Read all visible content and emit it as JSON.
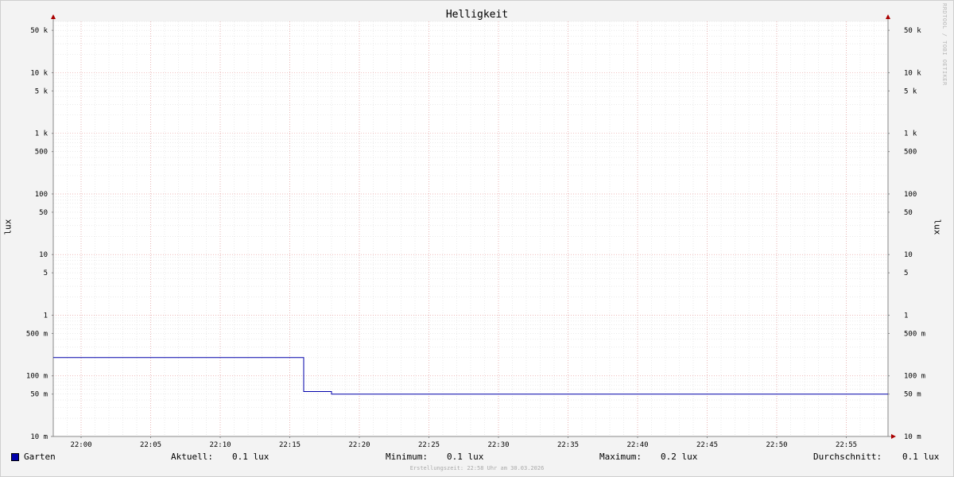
{
  "chart_data": {
    "type": "line",
    "title": "Helligkeit",
    "ylabel": "lux",
    "y_scale": "log",
    "ylim": [
      0.01,
      70000
    ],
    "y_ticks": [
      {
        "value": 50000,
        "label": "50 k"
      },
      {
        "value": 10000,
        "label": "10 k"
      },
      {
        "value": 5000,
        "label": "5 k"
      },
      {
        "value": 1000,
        "label": "1 k"
      },
      {
        "value": 500,
        "label": "500"
      },
      {
        "value": 100,
        "label": "100"
      },
      {
        "value": 50,
        "label": "50"
      },
      {
        "value": 10,
        "label": "10"
      },
      {
        "value": 5,
        "label": "5"
      },
      {
        "value": 1,
        "label": "1"
      },
      {
        "value": 0.5,
        "label": "500 m"
      },
      {
        "value": 0.1,
        "label": "100 m"
      },
      {
        "value": 0.05,
        "label": "50 m"
      },
      {
        "value": 0.01,
        "label": "10 m"
      }
    ],
    "x_ticks": [
      "22:00",
      "22:05",
      "22:10",
      "22:15",
      "22:20",
      "22:25",
      "22:30",
      "22:35",
      "22:40",
      "22:45",
      "22:50",
      "22:55"
    ],
    "xlim": [
      "21:58",
      "22:58"
    ],
    "grid": true,
    "series": [
      {
        "name": "Garten",
        "color": "#0000aa",
        "points": [
          {
            "x": "21:58",
            "y": 0.2
          },
          {
            "x": "22:16",
            "y": 0.2
          },
          {
            "x": "22:16",
            "y": 0.055
          },
          {
            "x": "22:18",
            "y": 0.055
          },
          {
            "x": "22:18",
            "y": 0.05
          },
          {
            "x": "22:58",
            "y": 0.05
          }
        ]
      }
    ]
  },
  "legend": {
    "series_name": "Garten",
    "color": "#0000aa",
    "stats": [
      {
        "label": "Aktuell:",
        "value": "0.1 lux"
      },
      {
        "label": "Minimum:",
        "value": "0.1 lux"
      },
      {
        "label": "Maximum:",
        "value": "0.2 lux"
      },
      {
        "label": "Durchschnitt:",
        "value": "0.1 lux"
      }
    ]
  },
  "watermark": "RRDTOOL / TOBI OETIKER",
  "footer": "Erstellungszeit: 22:58 Uhr am 30.03.2026"
}
